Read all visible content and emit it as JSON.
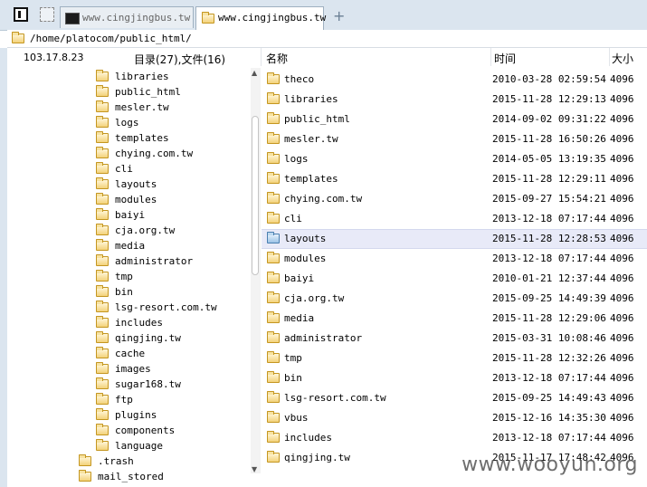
{
  "tabs": [
    {
      "label": "www.cingjingbus.tw",
      "active": false
    },
    {
      "label": "www.cingjingbus.tw",
      "active": true
    }
  ],
  "path": "/home/platocom/public_html/",
  "header": {
    "ip": "103.17.8.23",
    "count": "目录(27),文件(16)",
    "col_name": "名称",
    "col_time": "时间",
    "col_size": "大小"
  },
  "tree": [
    {
      "label": "libraries",
      "depth": 1
    },
    {
      "label": "public_html",
      "depth": 1
    },
    {
      "label": "mesler.tw",
      "depth": 1
    },
    {
      "label": "logs",
      "depth": 1
    },
    {
      "label": "templates",
      "depth": 1
    },
    {
      "label": "chying.com.tw",
      "depth": 1
    },
    {
      "label": "cli",
      "depth": 1
    },
    {
      "label": "layouts",
      "depth": 1
    },
    {
      "label": "modules",
      "depth": 1
    },
    {
      "label": "baiyi",
      "depth": 1
    },
    {
      "label": "cja.org.tw",
      "depth": 1
    },
    {
      "label": "media",
      "depth": 1
    },
    {
      "label": "administrator",
      "depth": 1
    },
    {
      "label": "tmp",
      "depth": 1
    },
    {
      "label": "bin",
      "depth": 1
    },
    {
      "label": "lsg-resort.com.tw",
      "depth": 1
    },
    {
      "label": "includes",
      "depth": 1
    },
    {
      "label": "qingjing.tw",
      "depth": 1
    },
    {
      "label": "cache",
      "depth": 1
    },
    {
      "label": "images",
      "depth": 1
    },
    {
      "label": "sugar168.tw",
      "depth": 1
    },
    {
      "label": "ftp",
      "depth": 1
    },
    {
      "label": "plugins",
      "depth": 1
    },
    {
      "label": "components",
      "depth": 1
    },
    {
      "label": "language",
      "depth": 1
    },
    {
      "label": ".trash",
      "depth": 0
    },
    {
      "label": "mail_stored",
      "depth": 0
    }
  ],
  "files": [
    {
      "name": "theco",
      "time": "2010-03-28 02:59:54",
      "size": "4096"
    },
    {
      "name": "libraries",
      "time": "2015-11-28 12:29:13",
      "size": "4096"
    },
    {
      "name": "public_html",
      "time": "2014-09-02 09:31:22",
      "size": "4096"
    },
    {
      "name": "mesler.tw",
      "time": "2015-11-28 16:50:26",
      "size": "4096"
    },
    {
      "name": "logs",
      "time": "2014-05-05 13:19:35",
      "size": "4096"
    },
    {
      "name": "templates",
      "time": "2015-11-28 12:29:11",
      "size": "4096"
    },
    {
      "name": "chying.com.tw",
      "time": "2015-09-27 15:54:21",
      "size": "4096"
    },
    {
      "name": "cli",
      "time": "2013-12-18 07:17:44",
      "size": "4096"
    },
    {
      "name": "layouts",
      "time": "2015-11-28 12:28:53",
      "size": "4096",
      "selected": true
    },
    {
      "name": "modules",
      "time": "2013-12-18 07:17:44",
      "size": "4096"
    },
    {
      "name": "baiyi",
      "time": "2010-01-21 12:37:44",
      "size": "4096"
    },
    {
      "name": "cja.org.tw",
      "time": "2015-09-25 14:49:39",
      "size": "4096"
    },
    {
      "name": "media",
      "time": "2015-11-28 12:29:06",
      "size": "4096"
    },
    {
      "name": "administrator",
      "time": "2015-03-31 10:08:46",
      "size": "4096"
    },
    {
      "name": "tmp",
      "time": "2015-11-28 12:32:26",
      "size": "4096"
    },
    {
      "name": "bin",
      "time": "2013-12-18 07:17:44",
      "size": "4096"
    },
    {
      "name": "lsg-resort.com.tw",
      "time": "2015-09-25 14:49:43",
      "size": "4096"
    },
    {
      "name": "vbus",
      "time": "2015-12-16 14:35:30",
      "size": "4096"
    },
    {
      "name": "includes",
      "time": "2013-12-18 07:17:44",
      "size": "4096"
    },
    {
      "name": "qingjing.tw",
      "time": "2015-11-17 17:48:42",
      "size": "4096"
    }
  ],
  "watermark": "www.wooyun.org",
  "colors": {
    "tabbar": "#dbe5ef",
    "selected_row": "#e8eaf8",
    "folder": "#f3d27a"
  },
  "icons": {
    "panel_toggle": "panel-icon",
    "terminal": "terminal-icon",
    "folder": "folder-icon",
    "new_tab": "plus-icon"
  }
}
